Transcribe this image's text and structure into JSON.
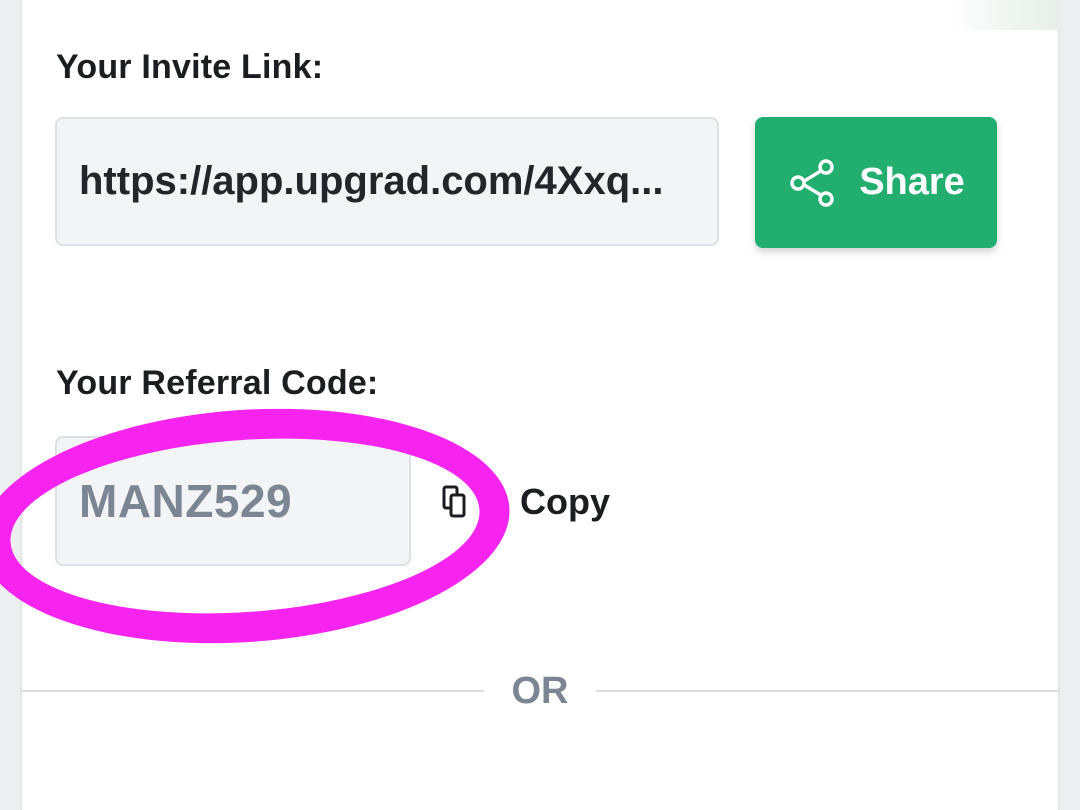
{
  "invite_section": {
    "label": "Your Invite Link:",
    "link_value": "https://app.upgrad.com/4Xxq...",
    "share_button_label": "Share",
    "share_icon": "share-icon",
    "share_button_color": "#21ae6f"
  },
  "referral_section": {
    "label": "Your Referral Code:",
    "code_value": "MANZ529",
    "copy_label": "Copy",
    "copy_icon": "copy-icon"
  },
  "divider": {
    "text": "OR"
  },
  "annotation": {
    "highlight_color": "#f724ef"
  }
}
